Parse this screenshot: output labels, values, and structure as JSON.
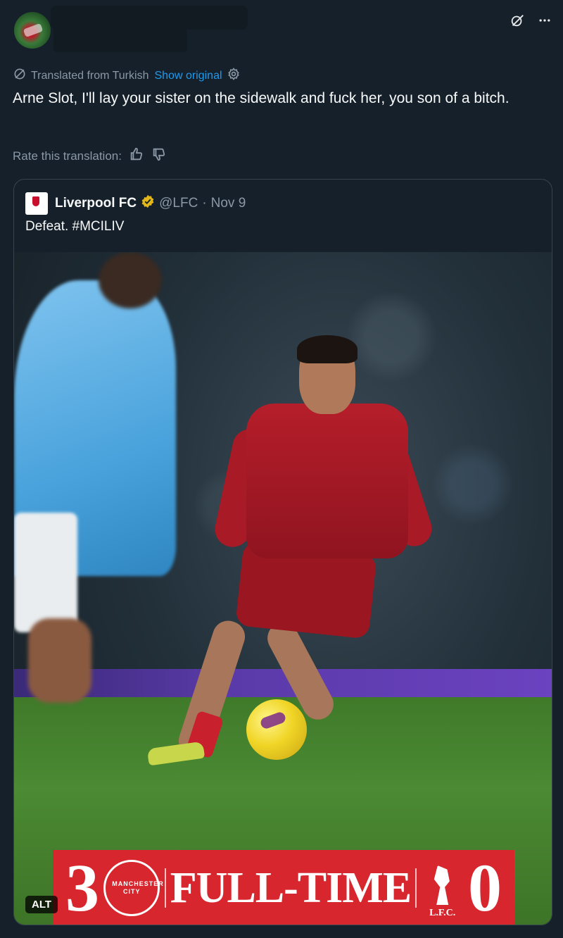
{
  "header": {
    "icons": [
      "grok-icon",
      "more-icon"
    ]
  },
  "translation": {
    "notice": "Translated from Turkish",
    "show_original": "Show original",
    "text": "Arne Slot, I'll lay your sister on the sidewalk and fuck her, you son of a bitch.",
    "rate_label": "Rate this translation:"
  },
  "quote": {
    "name": "Liverpool FC",
    "handle": "@LFC",
    "separator": "·",
    "date": "Nov 9",
    "text": "Defeat. #MCILIV",
    "alt_label": "ALT",
    "scoreboard": {
      "home_score": "3",
      "home_crest_text": "MANCHESTER CITY",
      "label": "FULL-TIME",
      "away_score": "0",
      "away_crest_text": "L.F.C."
    }
  },
  "colors": {
    "background": "#15202b",
    "link": "#1d9bf0",
    "muted": "#8b98a5",
    "banner_red": "#d7262e",
    "verified_gold": "#e2b719"
  }
}
